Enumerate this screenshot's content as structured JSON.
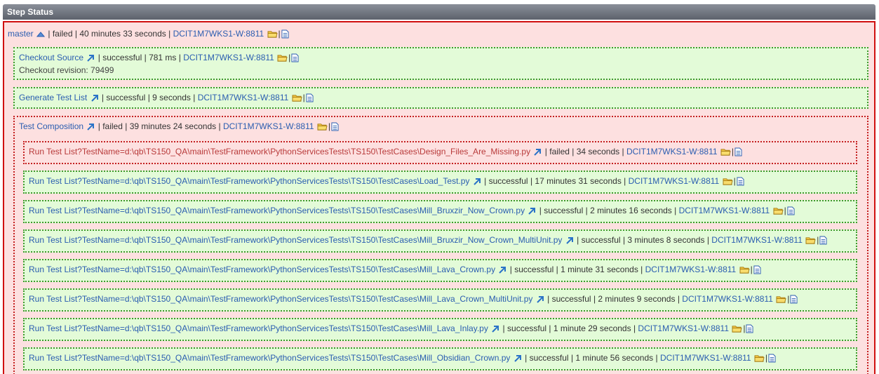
{
  "panel": {
    "title": "Step Status"
  },
  "root": {
    "name": "master",
    "status": "failed",
    "duration": "40 minutes 33 seconds",
    "host": "DCIT1M7WKS1-W:8811"
  },
  "steps": [
    {
      "name": "Checkout Source",
      "status": "successful",
      "duration": "781 ms",
      "host": "DCIT1M7WKS1-W:8811",
      "detail": "Checkout revision: 79499"
    },
    {
      "name": "Generate Test List",
      "status": "successful",
      "duration": "9 seconds",
      "host": "DCIT1M7WKS1-W:8811"
    },
    {
      "name": "Test Composition",
      "status": "failed",
      "duration": "39 minutes 24 seconds",
      "host": "DCIT1M7WKS1-W:8811"
    }
  ],
  "substeps": [
    {
      "name": "Run Test List?TestName=d:\\qb\\TS150_QA\\main\\TestFramework\\PythonServicesTests\\TS150\\TestCases\\Design_Files_Are_Missing.py",
      "status": "failed",
      "duration": "34 seconds",
      "host": "DCIT1M7WKS1-W:8811"
    },
    {
      "name": "Run Test List?TestName=d:\\qb\\TS150_QA\\main\\TestFramework\\PythonServicesTests\\TS150\\TestCases\\Load_Test.py",
      "status": "successful",
      "duration": "17 minutes 31 seconds",
      "host": "DCIT1M7WKS1-W:8811"
    },
    {
      "name": "Run Test List?TestName=d:\\qb\\TS150_QA\\main\\TestFramework\\PythonServicesTests\\TS150\\TestCases\\Mill_Bruxzir_Now_Crown.py",
      "status": "successful",
      "duration": "2 minutes 16 seconds",
      "host": "DCIT1M7WKS1-W:8811"
    },
    {
      "name": "Run Test List?TestName=d:\\qb\\TS150_QA\\main\\TestFramework\\PythonServicesTests\\TS150\\TestCases\\Mill_Bruxzir_Now_Crown_MultiUnit.py",
      "status": "successful",
      "duration": "3 minutes 8 seconds",
      "host": "DCIT1M7WKS1-W:8811"
    },
    {
      "name": "Run Test List?TestName=d:\\qb\\TS150_QA\\main\\TestFramework\\PythonServicesTests\\TS150\\TestCases\\Mill_Lava_Crown.py",
      "status": "successful",
      "duration": "1 minute 31 seconds",
      "host": "DCIT1M7WKS1-W:8811"
    },
    {
      "name": "Run Test List?TestName=d:\\qb\\TS150_QA\\main\\TestFramework\\PythonServicesTests\\TS150\\TestCases\\Mill_Lava_Crown_MultiUnit.py",
      "status": "successful",
      "duration": "2 minutes 9 seconds",
      "host": "DCIT1M7WKS1-W:8811"
    },
    {
      "name": "Run Test List?TestName=d:\\qb\\TS150_QA\\main\\TestFramework\\PythonServicesTests\\TS150\\TestCases\\Mill_Lava_Inlay.py",
      "status": "successful",
      "duration": "1 minute 29 seconds",
      "host": "DCIT1M7WKS1-W:8811"
    },
    {
      "name": "Run Test List?TestName=d:\\qb\\TS150_QA\\main\\TestFramework\\PythonServicesTests\\TS150\\TestCases\\Mill_Obsidian_Crown.py",
      "status": "successful",
      "duration": "1 minute 56 seconds",
      "host": "DCIT1M7WKS1-W:8811"
    }
  ],
  "colors": {
    "success_bg": "#e3fbd8",
    "success_border": "#3e9a2c",
    "failed_bg": "#fde0e0",
    "failed_border": "#c42020",
    "link": "#2a5db0"
  }
}
